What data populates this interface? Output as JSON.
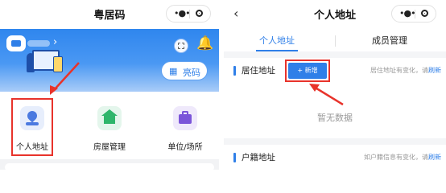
{
  "left": {
    "nav": {
      "title": "粤居码"
    },
    "banner": {
      "qr_label": "亮码"
    },
    "services": [
      {
        "label": "个人地址",
        "icon": "location-pin-icon",
        "color": "#4b7ae0",
        "bg": "#e7eefc"
      },
      {
        "label": "房屋管理",
        "icon": "house-icon",
        "color": "#2fb66b",
        "bg": "#e4f6ec"
      },
      {
        "label": "单位/场所",
        "icon": "briefcase-icon",
        "color": "#7b55d9",
        "bg": "#efe9fb"
      }
    ]
  },
  "right": {
    "nav": {
      "title": "个人地址"
    },
    "tabs": [
      {
        "label": "个人地址",
        "active": true
      },
      {
        "label": "成员管理",
        "active": false
      }
    ],
    "residence": {
      "title": "居住地址",
      "add_label": "+ 新增",
      "hint": "居住地址有变化，请",
      "hint_link": "刷新",
      "empty": "暂无数据"
    },
    "household": {
      "title": "户籍地址",
      "hint": "如户籍信息有变化，请",
      "hint_link": "刷新"
    }
  },
  "colors": {
    "accent": "#2f7fe8",
    "highlight": "#e8332b"
  }
}
